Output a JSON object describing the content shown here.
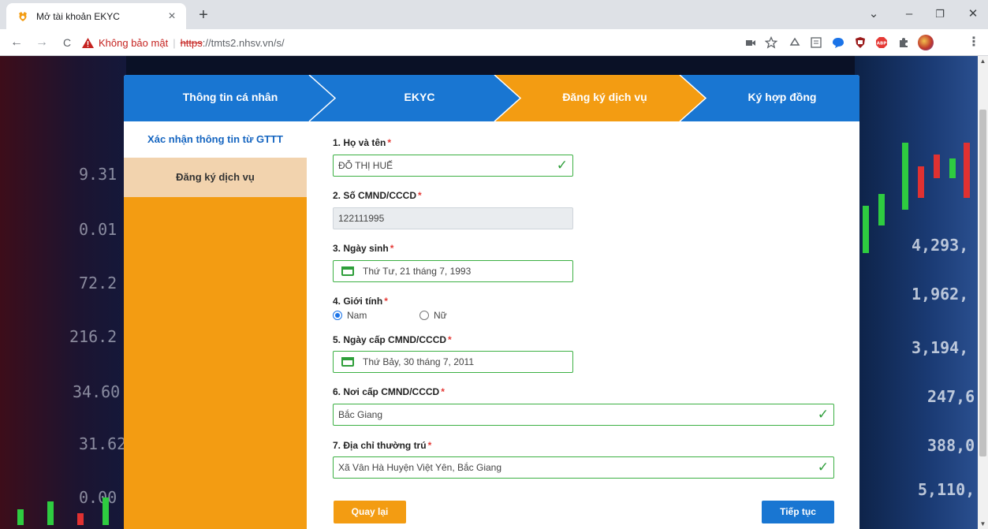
{
  "browser": {
    "tab_title": "Mở tài khoản EKYC",
    "tab_close": "×",
    "new_tab": "+",
    "security_label": "Không bảo mật",
    "url_scheme": "https",
    "url_rest": "://tmts2.nhsv.vn/s/",
    "window_controls": {
      "chevron": "⌄",
      "minimize": "–",
      "restore": "❐",
      "close": "✕"
    },
    "nav": {
      "back": "←",
      "forward": "→",
      "reload": "C"
    },
    "toolbar_icons": [
      "camera-icon",
      "star-icon",
      "recycle-icon",
      "reading-list-icon",
      "chat-icon",
      "ublock-icon",
      "adblock-icon",
      "extensions-icon",
      "profile-avatar",
      "menu-icon"
    ],
    "toolbar_menu": "⋮",
    "colors": {
      "insecure": "#c5221f",
      "chrome_bg": "#dee1e6"
    }
  },
  "background": {
    "left_numbers": [
      "9.31",
      "0.01",
      "72.2",
      "216.2",
      "34.60",
      "31.62",
      "0.00"
    ],
    "right_numbers": [
      "4,293,",
      "1,962,",
      "3,194,",
      "247,6",
      "388,0",
      "5,110,"
    ]
  },
  "wizard": {
    "steps": [
      {
        "label": "Thông tin cá nhân",
        "state": "done"
      },
      {
        "label": "EKYC",
        "state": "done"
      },
      {
        "label": "Đăng ký dịch vụ",
        "state": "active"
      },
      {
        "label": "Ký hợp đồng",
        "state": "todo"
      }
    ],
    "sidebar": {
      "active": "Xác nhận thông tin từ GTTT",
      "next": "Đăng ký dịch vụ"
    },
    "colors": {
      "blue": "#1976d2",
      "orange": "#f39c12",
      "valid": "#3cb043"
    }
  },
  "form": {
    "required_mark": "*",
    "full_name": {
      "label": "1. Họ và tên",
      "value": "ĐỖ THỊ HUẾ"
    },
    "id_number": {
      "label": "2. Số CMND/CCCD",
      "value": "122111995"
    },
    "dob": {
      "label": "3. Ngày sinh",
      "value": "Thứ Tư, 21 tháng 7, 1993"
    },
    "gender": {
      "label": "4. Giới tính",
      "options": [
        "Nam",
        "Nữ"
      ],
      "selected": "Nam"
    },
    "issue_date": {
      "label": "5. Ngày cấp CMND/CCCD",
      "value": "Thứ Bảy, 30 tháng 7, 2011"
    },
    "issue_place": {
      "label": "6. Nơi cấp CMND/CCCD",
      "value": "Bắc Giang"
    },
    "address": {
      "label": "7. Địa chỉ thường trú",
      "value": "Xã Vân Hà Huyện Việt Yên, Bắc Giang"
    },
    "check_mark": "✓",
    "back_button": "Quay lại",
    "next_button": "Tiếp tục"
  }
}
